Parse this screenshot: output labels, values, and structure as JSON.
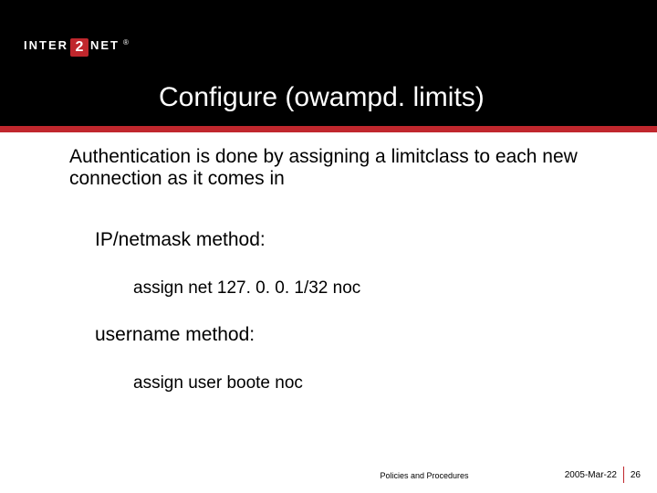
{
  "logo": {
    "left": "INTER",
    "mark": "2",
    "right": "NET",
    "reg": "®"
  },
  "title": "Configure (owampd. limits)",
  "intro": "Authentication is done by assigning a limitclass to each new connection as it comes in",
  "method1_label": "IP/netmask method:",
  "method1_code": "assign net 127. 0. 0. 1/32 noc",
  "method2_label": "username method:",
  "method2_code": "assign user boote noc",
  "footer": {
    "center": "Policies and Procedures",
    "date": "2005-Mar-22",
    "page": "26"
  }
}
